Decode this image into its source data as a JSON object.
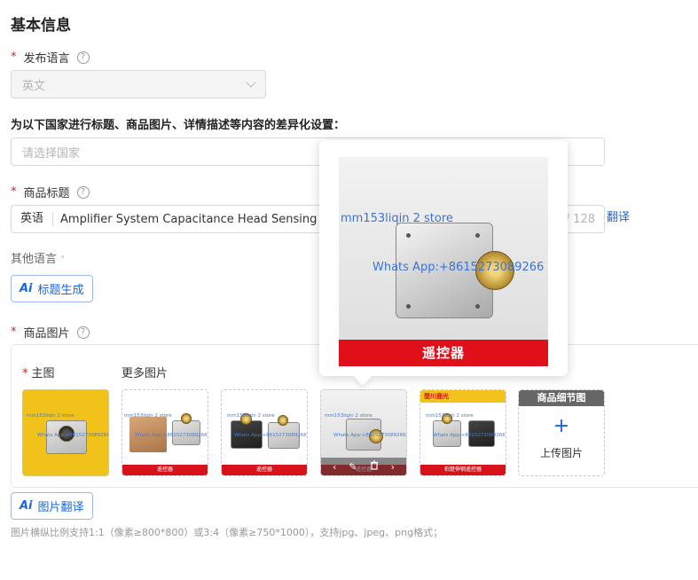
{
  "section": {
    "title": "基本信息"
  },
  "publish_language": {
    "label": "发布语言",
    "value": "英文"
  },
  "country_setting": {
    "label": "为以下国家进行标题、商品图片、详情描述等内容的差异化设置：",
    "placeholder": "请选择国家"
  },
  "product_title": {
    "label": "商品标题",
    "prefix": "英语",
    "value": "Amplifier System Capacitance Head Sensing Hea",
    "counter": "/ 128",
    "translate_link": "翻译"
  },
  "other_languages": {
    "label": "其他语言"
  },
  "ai_title_button": {
    "icon": "Ai",
    "label": "标题生成"
  },
  "product_images": {
    "label": "商品图片",
    "main_label": "主图",
    "more_label": "更多图片",
    "thumb_watermark": "mm153liqin 2 store",
    "thumb_watermark2": "Whats App:+8615273089266",
    "thumb_banner": "遥控器",
    "thumb5_header": "楚川鹿光",
    "thumb5_banner": "柏楚伸钢遥控器",
    "detail_tile": {
      "header": "商品细节图",
      "plus": "+",
      "upload_label": "上传图片"
    }
  },
  "ai_translate_button": {
    "icon": "Ai",
    "label": "图片翻译"
  },
  "hint": "图片横纵比例支持1:1（像素≥800*800）或3:4（像素≥750*1000），支持jpg、jpeg、png格式；",
  "popover": {
    "watermark_store": "mm153liqin 2 store",
    "watermark_phone": "Whats App:+8615273089266",
    "banner": "遥控器"
  },
  "colors": {
    "accent": "#1a66d8",
    "required": "#e02020",
    "banner_red": "#e0101a"
  }
}
